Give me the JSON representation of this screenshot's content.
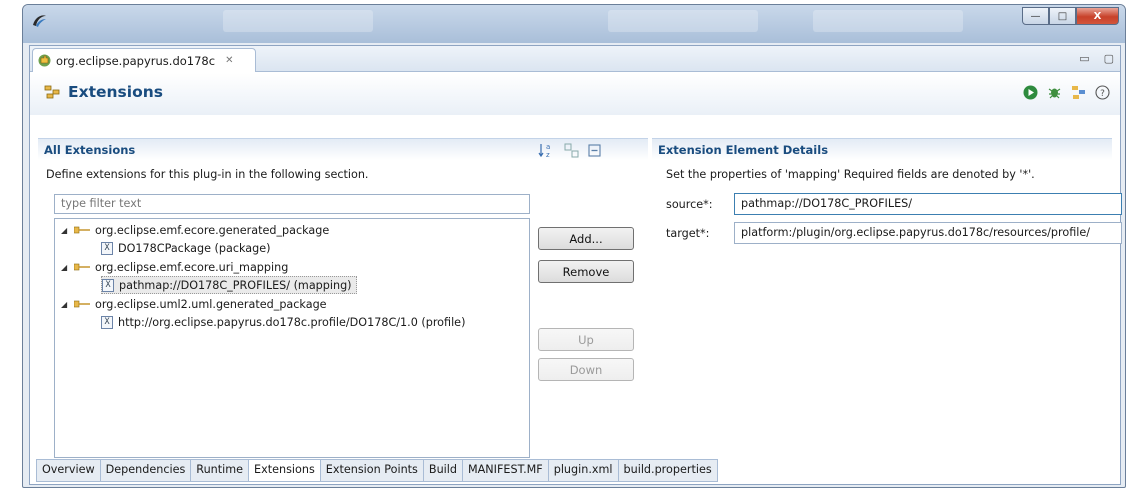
{
  "editor": {
    "tab_title": "org.eclipse.papyrus.do178c",
    "tab_close_glyph": "✕"
  },
  "window_controls": {
    "minimize": "—",
    "maximize": "□",
    "close": "X"
  },
  "view_controls": {
    "minimize": "▭",
    "maximize": "▢"
  },
  "form": {
    "title": "Extensions",
    "tools": [
      "run-icon",
      "debug-icon",
      "extensions-icon",
      "help-icon"
    ]
  },
  "all_extensions": {
    "heading": "All Extensions",
    "description": "Define extensions for this plug-in in the following section.",
    "filter_placeholder": "type filter text",
    "tree": [
      {
        "label": "org.eclipse.emf.ecore.generated_package",
        "level": 0,
        "expanded": true
      },
      {
        "label": "DO178CPackage (package)",
        "level": 1
      },
      {
        "label": "org.eclipse.emf.ecore.uri_mapping",
        "level": 0,
        "expanded": true
      },
      {
        "label": "pathmap://DO178C_PROFILES/ (mapping)",
        "level": 1,
        "selected": true
      },
      {
        "label": "org.eclipse.uml2.uml.generated_package",
        "level": 0,
        "expanded": true
      },
      {
        "label": "http://org.eclipse.papyrus.do178c.profile/DO178C/1.0 (profile)",
        "level": 1
      }
    ],
    "buttons": {
      "add": "Add...",
      "remove": "Remove",
      "up": "Up",
      "down": "Down"
    }
  },
  "details": {
    "heading": "Extension Element Details",
    "description": "Set the properties of 'mapping' Required fields are denoted by '*'.",
    "source_label": "source*:",
    "source_value": "pathmap://DO178C_PROFILES/",
    "target_label": "target*:",
    "target_value": "platform:/plugin/org.eclipse.papyrus.do178c/resources/profile/"
  },
  "page_tabs": [
    {
      "label": "Overview"
    },
    {
      "label": "Dependencies"
    },
    {
      "label": "Runtime"
    },
    {
      "label": "Extensions",
      "active": true
    },
    {
      "label": "Extension Points"
    },
    {
      "label": "Build"
    },
    {
      "label": "MANIFEST.MF"
    },
    {
      "label": "plugin.xml"
    },
    {
      "label": "build.properties"
    }
  ],
  "colors": {
    "accent": "#194c7f",
    "frame": "#6b7f99",
    "close": "#c8412a"
  }
}
